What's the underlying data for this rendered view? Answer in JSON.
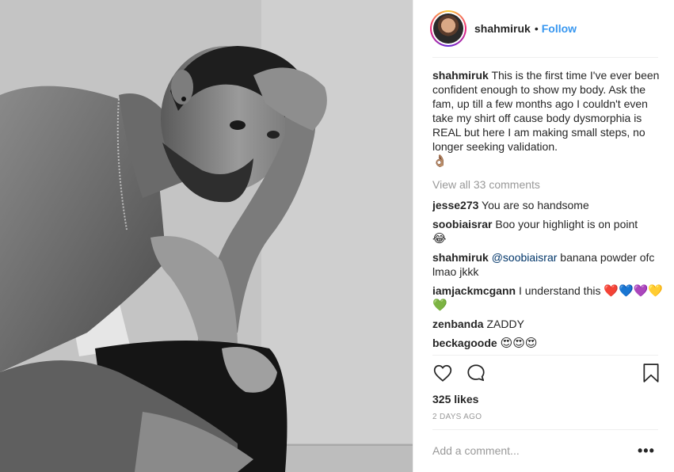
{
  "post": {
    "username": "shahmiruk",
    "dot": "•",
    "follow_label": "Follow",
    "caption_user": "shahmiruk",
    "caption_text": "This is the first time I've ever been confident enough to show my body. Ask the fam, up till a few months ago I couldn't even take my shirt off cause body dysmorphia is REAL but here I am making small steps, no longer seeking validation.",
    "caption_emoji": "👌🏽",
    "view_all": "View all 33 comments",
    "likes": "325 likes",
    "timestamp": "2 DAYS AGO",
    "add_comment_placeholder": "Add a comment...",
    "more_label": "•••"
  },
  "comments": [
    {
      "user": "jesse273",
      "text": "You are so handsome"
    },
    {
      "user": "soobiaisrar",
      "text": "Boo your highlight is on point",
      "emoji": "😂"
    },
    {
      "user": "shahmiruk",
      "mention": "@soobiaisrar",
      "text": "banana powder ofc lmao jkkk"
    },
    {
      "user": "iamjackmcgann",
      "text": "I understand this",
      "emoji": "❤️💙💜💛💚"
    },
    {
      "user": "zenbanda",
      "text": "ZADDY"
    },
    {
      "user": "beckagoode",
      "text": "",
      "emoji": "😍😍😍"
    }
  ],
  "icons": {
    "like": "heart-outline-icon",
    "comment": "speech-bubble-icon",
    "save": "bookmark-icon"
  },
  "colors": {
    "link": "#3897f0",
    "secondary_text": "#999999",
    "primary_text": "#262626",
    "mention": "#003569"
  }
}
